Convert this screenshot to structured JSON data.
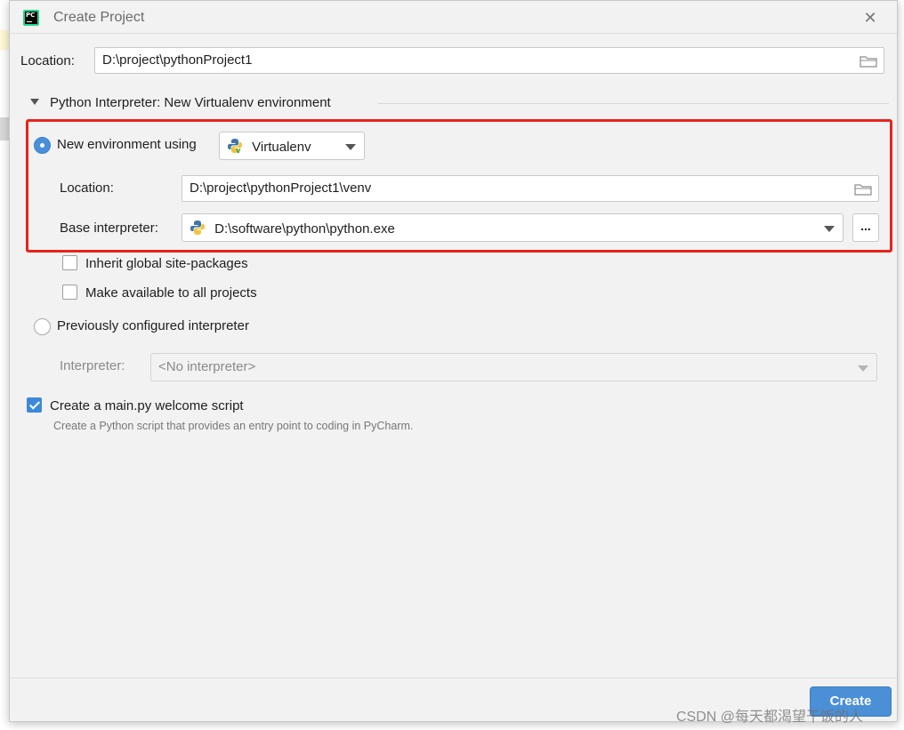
{
  "dialog": {
    "title": "Create Project",
    "close_glyph": "✕",
    "app_logo_text": "PC"
  },
  "location": {
    "label": "Location:",
    "value": "D:\\project\\pythonProject1"
  },
  "interpreter_section": {
    "title": "Python Interpreter: New Virtualenv environment",
    "new_env": {
      "radio_label": "New environment using",
      "selected": true,
      "tool": "Virtualenv",
      "location_label": "Location:",
      "location_value": "D:\\project\\pythonProject1\\venv",
      "base_label": "Base interpreter:",
      "base_value": "D:\\software\\python\\python.exe",
      "browse_label": "..."
    },
    "inherit_label": "Inherit global site-packages",
    "inherit_checked": false,
    "available_label": "Make available to all projects",
    "available_checked": false,
    "previous": {
      "radio_label": "Previously configured interpreter",
      "selected": false,
      "interpreter_label": "Interpreter:",
      "interpreter_value": "<No interpreter>"
    }
  },
  "welcome": {
    "label": "Create a main.py welcome script",
    "checked": true,
    "hint": "Create a Python script that provides an entry point to coding in PyCharm."
  },
  "footer": {
    "create_label": "Create"
  },
  "watermark": "CSDN @每天都渴望干饭的人",
  "colors": {
    "accent": "#4a8fd9",
    "highlight_border": "#e8231b"
  },
  "icons": [
    "pycharm-logo-icon",
    "close-icon",
    "folder-icon",
    "collapse-triangle-icon",
    "python-icon",
    "chevron-down-icon"
  ]
}
